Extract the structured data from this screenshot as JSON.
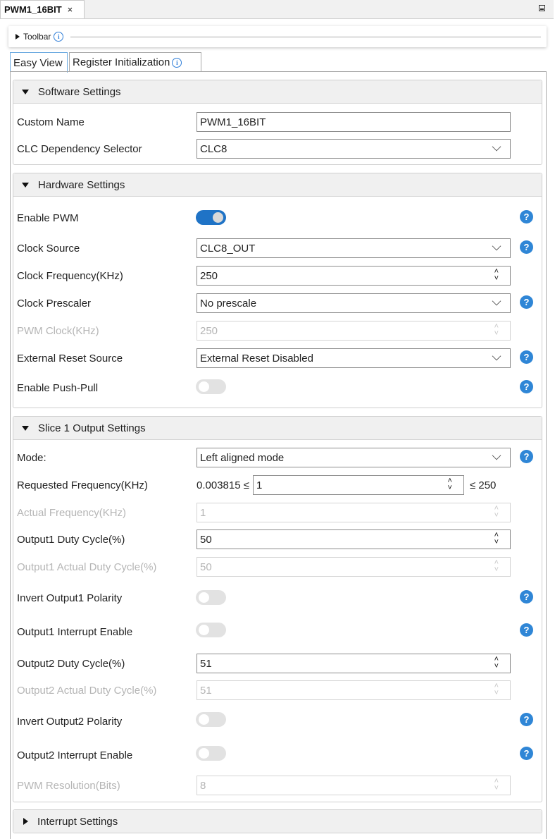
{
  "tab": {
    "title": "PWM1_16BIT",
    "close": "×"
  },
  "toolbar": {
    "label": "Toolbar",
    "info": "i"
  },
  "view_tabs": [
    {
      "label": "Easy View",
      "active": true
    },
    {
      "label": "Register Initialization",
      "info": "i"
    }
  ],
  "software": {
    "title": "Software Settings",
    "custom_name_label": "Custom Name",
    "custom_name_value": "PWM1_16BIT",
    "clc_label": "CLC Dependency Selector",
    "clc_value": "CLC8"
  },
  "hardware": {
    "title": "Hardware Settings",
    "enable_pwm_label": "Enable PWM",
    "enable_pwm": true,
    "clock_source_label": "Clock Source",
    "clock_source_value": "CLC8_OUT",
    "clock_freq_label": "Clock Frequency(KHz)",
    "clock_freq_value": "250",
    "prescaler_label": "Clock Prescaler",
    "prescaler_value": "No prescale",
    "pwm_clock_label": "PWM Clock(KHz)",
    "pwm_clock_value": "250",
    "ext_reset_label": "External Reset Source",
    "ext_reset_value": "External Reset Disabled",
    "push_pull_label": "Enable Push-Pull",
    "push_pull": false
  },
  "slice1": {
    "title": "Slice 1 Output Settings",
    "mode_label": "Mode:",
    "mode_value": "Left aligned mode",
    "req_freq_label": "Requested Frequency(KHz)",
    "req_freq_min": "0.003815 ≤",
    "req_freq_value": "1",
    "req_freq_max": "≤ 250",
    "actual_freq_label": "Actual Frequency(KHz)",
    "actual_freq_value": "1",
    "out1_duty_label": "Output1 Duty Cycle(%)",
    "out1_duty_value": "50",
    "out1_actual_label": "Output1 Actual Duty Cycle(%)",
    "out1_actual_value": "50",
    "invert1_label": "Invert Output1 Polarity",
    "int1_label": "Output1 Interrupt Enable",
    "out2_duty_label": "Output2 Duty Cycle(%)",
    "out2_duty_value": "51",
    "out2_actual_label": "Output2 Actual Duty Cycle(%)",
    "out2_actual_value": "51",
    "invert2_label": "Invert Output2 Polarity",
    "int2_label": "Output2 Interrupt Enable",
    "resolution_label": "PWM Resolution(Bits)",
    "resolution_value": "8"
  },
  "interrupt": {
    "title": "Interrupt Settings"
  },
  "help_glyph": "?",
  "colors": {
    "accent": "#1f73c6",
    "help": "#2f86d6",
    "disabled_text": "#b5b5b5"
  }
}
